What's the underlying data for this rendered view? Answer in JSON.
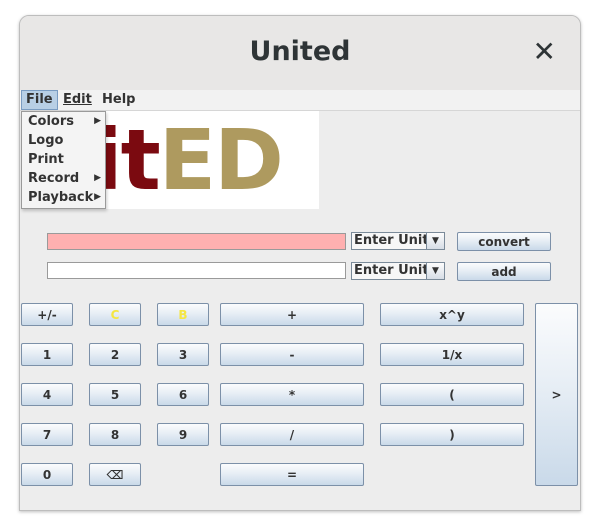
{
  "window": {
    "title": "United"
  },
  "menu": {
    "file": "File",
    "edit": "Edit",
    "help": "Help"
  },
  "file_menu": [
    {
      "label": "Colors",
      "submenu": true
    },
    {
      "label": "Logo",
      "submenu": false
    },
    {
      "label": "Print",
      "submenu": false
    },
    {
      "label": "Record",
      "submenu": true
    },
    {
      "label": "Playback",
      "submenu": true
    }
  ],
  "logo": {
    "part1": "nit",
    "part2": "ED",
    "colors": {
      "part1": "#7b0a10",
      "part2": "#ae9a5f"
    }
  },
  "inputs": {
    "top": {
      "value": "",
      "color": "#ffb0b0"
    },
    "bottom": {
      "value": "",
      "color": "#ffffff"
    },
    "unit_top": "Enter Unit",
    "unit_bottom": "Enter Unit",
    "convert": "convert",
    "add": "add"
  },
  "keypad": {
    "plusminus": "+/-",
    "clear": "C",
    "backspace_word": "B",
    "one": "1",
    "two": "2",
    "three": "3",
    "four": "4",
    "five": "5",
    "six": "6",
    "seven": "7",
    "eight": "8",
    "nine": "9",
    "zero": "0",
    "backspace": "⌫",
    "plus": "+",
    "minus": "-",
    "times": "*",
    "divide": "/",
    "equals": "=",
    "power": "x^y",
    "reciprocal": "1/x",
    "lparen": "(",
    "rparen": ")",
    "next": ">"
  }
}
